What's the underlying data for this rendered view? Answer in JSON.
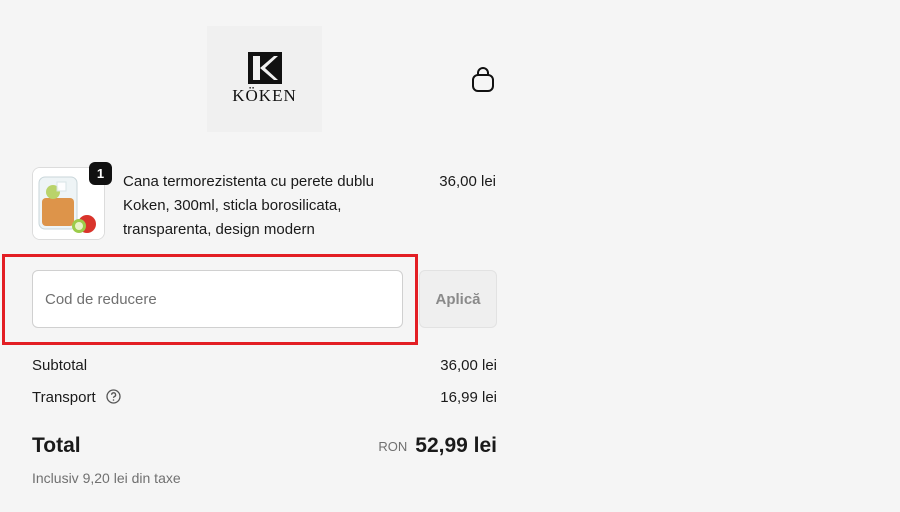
{
  "brand": {
    "name": "KÖKEN",
    "monogram": "K"
  },
  "header": {
    "cart_icon": "shopping-bag-icon"
  },
  "product": {
    "quantity": "1",
    "title": "Cana termorezistenta cu perete dublu Koken, 300ml, sticla borosilicata, transparenta, design modern",
    "price": "36,00 lei"
  },
  "discount": {
    "placeholder": "Cod de reducere",
    "value": "",
    "apply_label": "Aplică"
  },
  "summary": {
    "subtotal_label": "Subtotal",
    "subtotal_value": "36,00 lei",
    "shipping_label": "Transport",
    "shipping_value": "16,99 lei",
    "total_label": "Total",
    "currency": "RON",
    "total_value": "52,99 lei",
    "tax_note": "Inclusiv 9,20 lei din taxe"
  },
  "colors": {
    "highlight": "#e31e24",
    "badge": "#111111",
    "muted": "#707070"
  }
}
